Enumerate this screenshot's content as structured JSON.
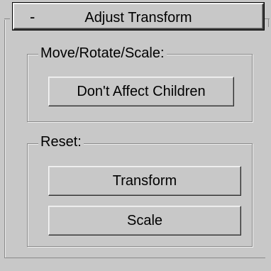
{
  "rollout": {
    "collapse_glyph": "-",
    "title": "Adjust Transform"
  },
  "move_group": {
    "label": "Move/Rotate/Scale:",
    "dont_affect_children_label": "Don't Affect Children"
  },
  "reset_group": {
    "label": "Reset:",
    "transform_label": "Transform",
    "scale_label": "Scale"
  }
}
